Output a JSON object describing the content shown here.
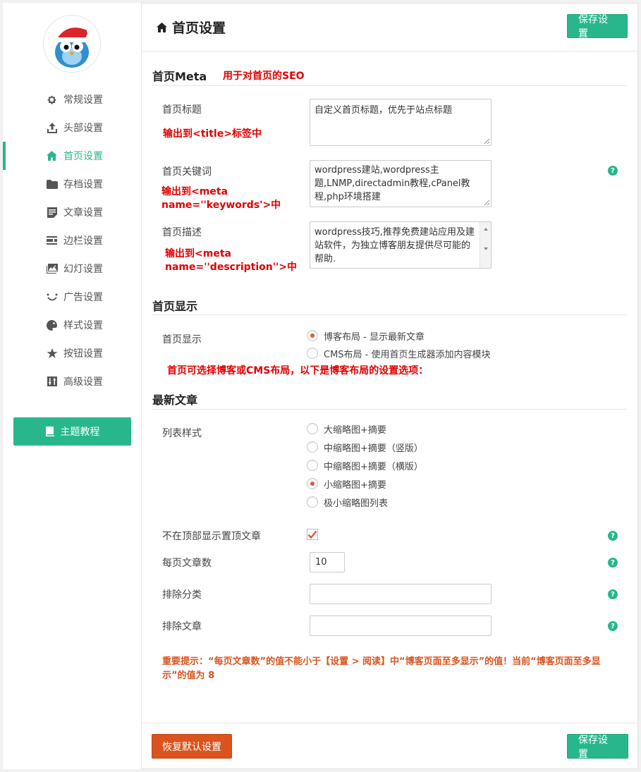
{
  "sidebar": {
    "items": [
      {
        "label": "常规设置",
        "icon": "gear-icon"
      },
      {
        "label": "头部设置",
        "icon": "upload-icon"
      },
      {
        "label": "首页设置",
        "icon": "home-icon"
      },
      {
        "label": "存档设置",
        "icon": "folder-icon"
      },
      {
        "label": "文章设置",
        "icon": "document-icon"
      },
      {
        "label": "边栏设置",
        "icon": "sidebar-icon"
      },
      {
        "label": "幻灯设置",
        "icon": "image-icon"
      },
      {
        "label": "广告设置",
        "icon": "smile-icon"
      },
      {
        "label": "样式设置",
        "icon": "palette-icon"
      },
      {
        "label": "按钮设置",
        "icon": "star-icon"
      },
      {
        "label": "高级设置",
        "icon": "sliders-icon"
      }
    ],
    "active_index": 2,
    "tutorial_label": "主题教程"
  },
  "header": {
    "title": "首页设置",
    "save_label": "保存设置"
  },
  "meta_section": {
    "title": "首页Meta",
    "note": "用于对首页的SEO",
    "home_title_label": "首页标题",
    "home_title_note": "输出到<title>标签中",
    "home_title_value": "自定义首页标题，优先于站点标题",
    "keywords_label": "首页关键词",
    "keywords_note_1": "输出到<meta",
    "keywords_note_2": "name=''keywords'>中",
    "keywords_value": "wordpress建站,wordpress主题,LNMP,directadmin教程,cPanel教程,php环境搭建",
    "desc_label": "首页描述",
    "desc_note_1": "输出到<meta",
    "desc_note_2": "name=''description''>中",
    "desc_value": "wordpress技巧,推荐免费建站应用及建站软件，为独立博客朋友提供尽可能的帮助."
  },
  "display_section": {
    "title": "首页显示",
    "label": "首页显示",
    "option_blog": "博客布局 - 显示最新文章",
    "option_cms": "CMS布局 - 使用首页生成器添加内容模块",
    "selected": "blog",
    "note": "首页可选择博客或CMS布局，以下是博客布局的设置选项："
  },
  "latest_section": {
    "title": "最新文章",
    "list_style_label": "列表样式",
    "list_styles": [
      "大缩略图+摘要",
      "中缩略图+摘要（竖版）",
      "中缩略图+摘要（横版）",
      "小缩略图+摘要",
      "极小缩略图列表"
    ],
    "selected_style_index": 3,
    "hide_sticky_label": "不在顶部显示置顶文章",
    "hide_sticky_checked": true,
    "per_page_label": "每页文章数",
    "per_page_value": "10",
    "exclude_cat_label": "排除分类",
    "exclude_cat_value": "",
    "exclude_post_label": "排除文章",
    "exclude_post_value": ""
  },
  "warning": "重要提示：“每页文章数”的值不能小于【设置 > 阅读】中“博客页面至多显示”的值！当前“博客页面至多显示”的值为 8",
  "footer": {
    "reset_label": "恢复默认设置",
    "save_label": "保存设置"
  },
  "help_glyph": "?",
  "colors": {
    "accent": "#28b78d",
    "danger": "#d9541e",
    "note_red": "#e00000"
  }
}
